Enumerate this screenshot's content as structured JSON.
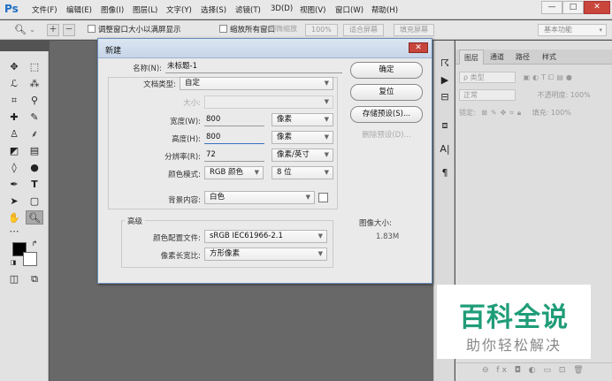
{
  "app": {
    "logo": "Ps"
  },
  "menubar": {
    "items": [
      "文件(F)",
      "编辑(E)",
      "图像(I)",
      "图层(L)",
      "文字(Y)",
      "选择(S)",
      "滤镜(T)",
      "3D(D)",
      "视图(V)",
      "窗口(W)",
      "帮助(H)"
    ],
    "window_controls": {
      "minimize": "—",
      "restore": "□",
      "close": "✕"
    }
  },
  "options": {
    "resize_windows": "调整窗口大小以满屏显示",
    "zoom_all": "缩放所有窗口",
    "scrubby_zoom": "细微缩放",
    "zoom_100": "100%",
    "fit_screen": "适合屏幕",
    "fill_screen": "填充屏幕",
    "workspace": "基本功能"
  },
  "dialog": {
    "title": "新建",
    "name_label": "名称(N):",
    "name_value": "未标题-1",
    "preset_label": "文档类型:",
    "preset_value": "自定",
    "size_label": "大小:",
    "width_label": "宽度(W):",
    "width_value": "800",
    "width_unit": "像素",
    "height_label": "高度(H):",
    "height_value": "800",
    "height_unit": "像素",
    "resolution_label": "分辨率(R):",
    "resolution_value": "72",
    "resolution_unit": "像素/英寸",
    "color_mode_label": "颜色模式:",
    "color_mode_value": "RGB 颜色",
    "bit_depth_value": "8 位",
    "bg_label": "背景内容:",
    "bg_value": "白色",
    "advanced_label": "高级",
    "profile_label": "颜色配置文件:",
    "profile_value": "sRGB IEC61966-2.1",
    "aspect_label": "像素长宽比:",
    "aspect_value": "方形像素",
    "image_size_label": "图像大小:",
    "image_size_value": "1.83M",
    "ok": "确定",
    "reset": "复位",
    "save_preset": "存储预设(S)...",
    "delete_preset": "删除预设(D)...",
    "close": "✕"
  },
  "layers": {
    "tabs": [
      "图层",
      "通道",
      "路径",
      "样式"
    ],
    "kind_filter": "ρ 类型",
    "blend_mode": "正常",
    "opacity_label": "不透明度:",
    "opacity_value": "100%",
    "lock_label": "锁定:",
    "fill_label": "填充:",
    "fill_value": "100%",
    "footer_icons": "⊖  fx  ◘  ◐  ▭  ⊡  🗑"
  },
  "watermark": {
    "title": "百科全说",
    "subtitle": "助你轻松解决"
  }
}
